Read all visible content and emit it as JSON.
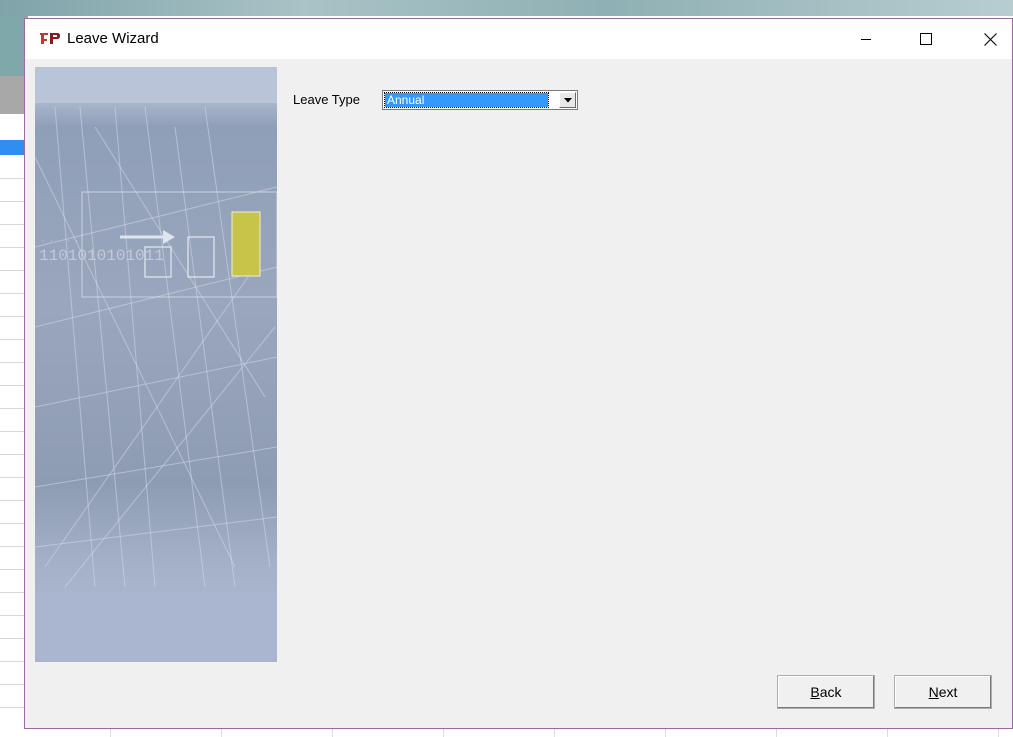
{
  "window": {
    "title": "Leave Wizard",
    "caption_buttons": {
      "minimize": "minimize-icon",
      "maximize": "maximize-icon",
      "close": "close-icon"
    }
  },
  "banner": {
    "binary_text": "1101010101011",
    "image": "wizard-banner-graphic"
  },
  "form": {
    "leave_type_label": "Leave Type",
    "leave_type_value": "Annual"
  },
  "buttons": {
    "back": {
      "accel": "B",
      "rest": "ack"
    },
    "next": {
      "accel": "N",
      "rest": "ext"
    }
  },
  "colors": {
    "selection": "#3399ff",
    "window_border": "#9a6aa6",
    "dialog_bg": "#f0f0f0",
    "banner_accent": "#c8c44a"
  }
}
